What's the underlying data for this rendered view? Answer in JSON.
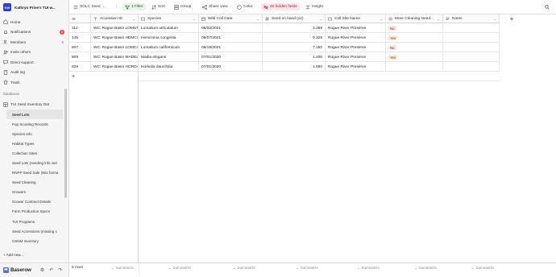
{
  "workspace": {
    "logo": "KW",
    "name": "Kathryn Prive's TUI w..."
  },
  "nav": [
    {
      "label": "Home",
      "icon": "home-icon"
    },
    {
      "label": "Notifications",
      "icon": "bell-icon",
      "badge": "6"
    },
    {
      "label": "Members",
      "icon": "users-icon",
      "count": "5"
    },
    {
      "label": "Invite others",
      "icon": "user-plus-icon"
    },
    {
      "label": "Direct support",
      "icon": "chat-icon"
    },
    {
      "label": "Audit log",
      "icon": "book-icon"
    },
    {
      "label": "Trash",
      "icon": "trash-icon"
    }
  ],
  "databases_label": "Databases",
  "database": {
    "name": "TUI Seed Inventory Dat"
  },
  "tables": [
    "Seed Lots",
    "Pop Scouting Records",
    "Species Info",
    "Habitat Types",
    "Collection Sites",
    "Seed Lots (needing info veri",
    "RNPP Seed Sale (Wix forma",
    "Seed Cleaning",
    "Growers",
    "Grower Contract Details",
    "Farm Production Specs",
    "TUI Programs",
    "Seed Accessions (missing s",
    "CSNM Inventory"
  ],
  "add_new": "+ Add new...",
  "brand": "Baserow",
  "toolbar": {
    "view_name": "SOLC Seed",
    "filter": "1 Filter",
    "sort": "Sort",
    "group": "Group",
    "share": "Share view",
    "color": "Color",
    "hidden": "32 hidden fields",
    "height": "Height"
  },
  "columns": {
    "accession": "Accession ID",
    "species": "Species",
    "wild_date": "Wild Coll Date",
    "seed_oz": "Seed on hand (oz)",
    "site": "Coll Site Name",
    "cleaning": "More Cleaning Need...",
    "notes": "Notes"
  },
  "rows": [
    {
      "id": "112",
      "accession": "WC: Rogue Basin LOMUT",
      "species": "Lomatium utriculatum",
      "wild_date": "06/02/2021",
      "seed_oz": "3.358",
      "site": "Rogue River Preserve",
      "cleaning": "No"
    },
    {
      "id": "145",
      "accession": "WC: Rogue Basin HEMCO",
      "species": "Hemizonia congesta",
      "wild_date": "09/07/2021",
      "seed_oz": "0.325",
      "site": "Rogue River Preserve",
      "cleaning": "Yes"
    },
    {
      "id": "807",
      "accession": "WC: Rogue Basin LOMCA",
      "species": "Lomatium californicum",
      "wild_date": "06/19/2021",
      "seed_oz": "7.150",
      "site": "Rogue River Preserve",
      "cleaning": "No"
    },
    {
      "id": "809",
      "accession": "WC: Rogue Basin MADEL",
      "species": "Madia elegans",
      "wild_date": "07/01/2020",
      "seed_oz": "1.200",
      "site": "Rogue River Preserve",
      "cleaning": "Yes"
    },
    {
      "id": "828",
      "accession": "WC: Rogue Basin HORDA",
      "species": "Horkelia daucifolia",
      "wild_date": "07/01/2020",
      "seed_oz": "1.690",
      "site": "Rogue River Preserve",
      "cleaning": ""
    }
  ],
  "footer": {
    "rows": "5 rows",
    "summarize": "Summarize"
  }
}
